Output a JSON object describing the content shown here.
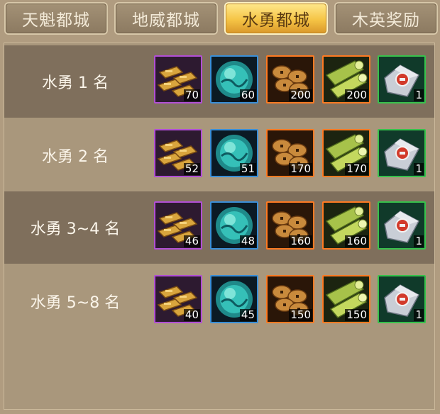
{
  "tabs": [
    {
      "label": "天魁都城",
      "active": false
    },
    {
      "label": "地威都城",
      "active": false
    },
    {
      "label": "水勇都城",
      "active": true
    },
    {
      "label": "木英奖励",
      "active": false
    }
  ],
  "rows": [
    {
      "label": "水勇 1 名",
      "items": [
        {
          "icon": "gold-bars-icon",
          "qty": "70"
        },
        {
          "icon": "jade-orb-icon",
          "qty": "60"
        },
        {
          "icon": "copper-coins-icon",
          "qty": "200"
        },
        {
          "icon": "bamboo-logs-icon",
          "qty": "200"
        },
        {
          "icon": "silver-pouch-icon",
          "qty": "1"
        }
      ]
    },
    {
      "label": "水勇 2 名",
      "items": [
        {
          "icon": "gold-bars-icon",
          "qty": "52"
        },
        {
          "icon": "jade-orb-icon",
          "qty": "51"
        },
        {
          "icon": "copper-coins-icon",
          "qty": "170"
        },
        {
          "icon": "bamboo-logs-icon",
          "qty": "170"
        },
        {
          "icon": "silver-pouch-icon",
          "qty": "1"
        }
      ]
    },
    {
      "label": "水勇 3~4 名",
      "items": [
        {
          "icon": "gold-bars-icon",
          "qty": "46"
        },
        {
          "icon": "jade-orb-icon",
          "qty": "48"
        },
        {
          "icon": "copper-coins-icon",
          "qty": "160"
        },
        {
          "icon": "bamboo-logs-icon",
          "qty": "160"
        },
        {
          "icon": "silver-pouch-icon",
          "qty": "1"
        }
      ]
    },
    {
      "label": "水勇 5~8 名",
      "items": [
        {
          "icon": "gold-bars-icon",
          "qty": "40"
        },
        {
          "icon": "jade-orb-icon",
          "qty": "45"
        },
        {
          "icon": "copper-coins-icon",
          "qty": "150"
        },
        {
          "icon": "bamboo-logs-icon",
          "qty": "150"
        },
        {
          "icon": "silver-pouch-icon",
          "qty": "1"
        }
      ]
    }
  ],
  "colors": {
    "tab_active": "#f5c445",
    "rarity_purple": "#b24fd6",
    "rarity_blue": "#3a8fd8",
    "rarity_orange": "#ff7a22",
    "rarity_green": "#37c24c"
  }
}
